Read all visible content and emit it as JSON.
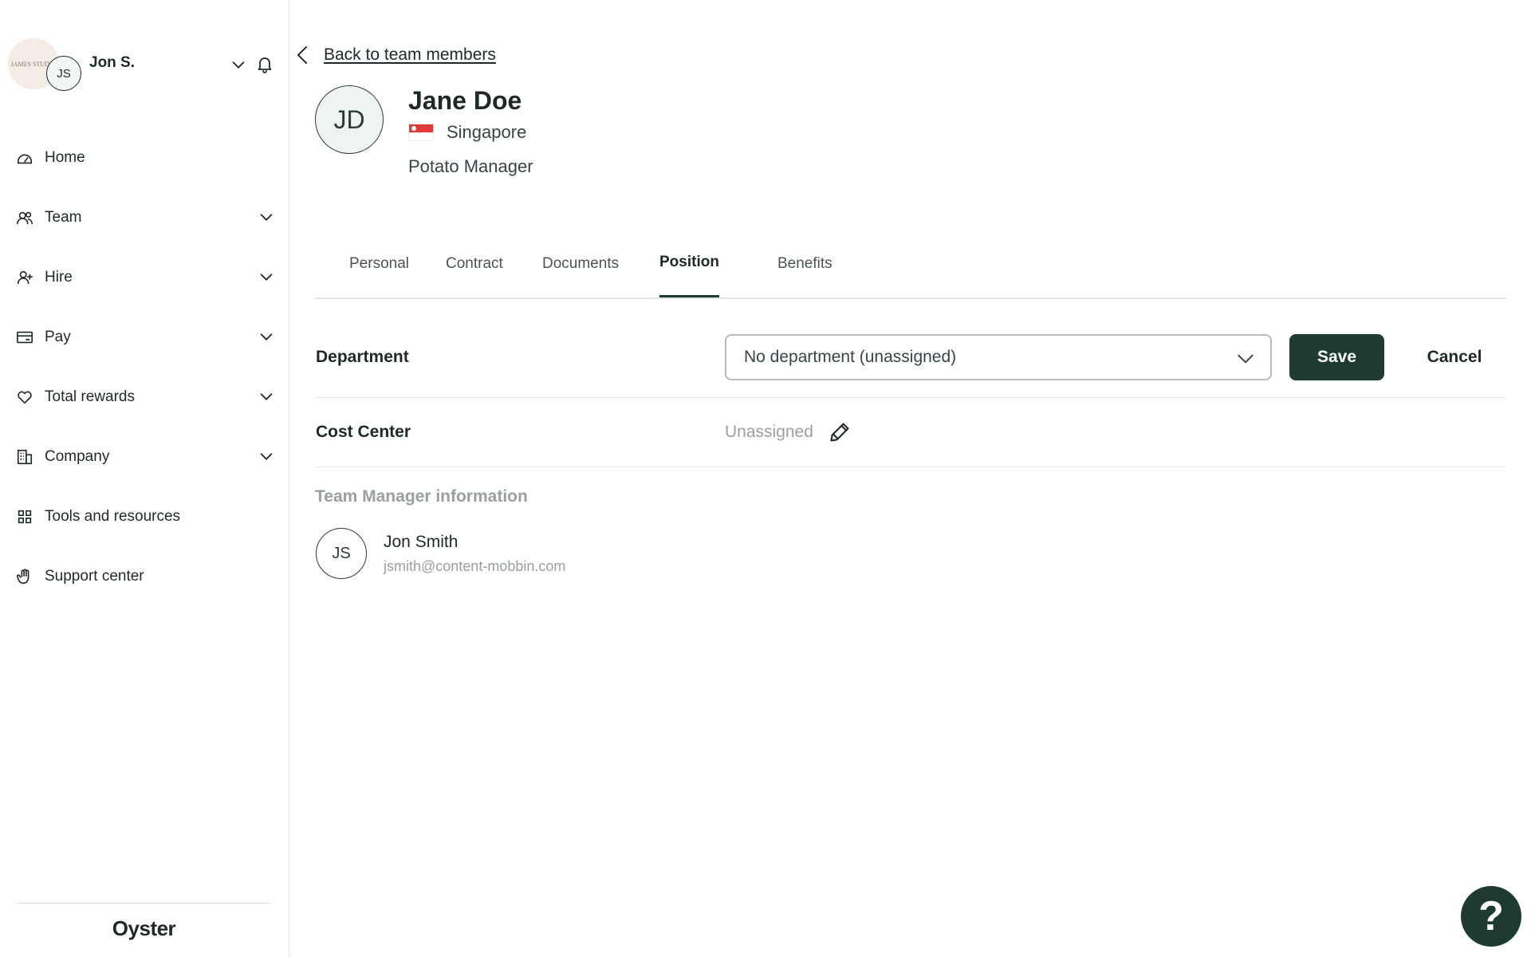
{
  "user": {
    "company_logo_text": "JAMES STUDIO",
    "avatar_initials": "JS",
    "name": "Jon S."
  },
  "nav": {
    "items": [
      {
        "label": "Home",
        "icon": "home-icon",
        "expandable": false
      },
      {
        "label": "Team",
        "icon": "team-icon",
        "expandable": true
      },
      {
        "label": "Hire",
        "icon": "hire-icon",
        "expandable": true
      },
      {
        "label": "Pay",
        "icon": "pay-icon",
        "expandable": true
      },
      {
        "label": "Total rewards",
        "icon": "heart-icon",
        "expandable": true
      },
      {
        "label": "Company",
        "icon": "company-icon",
        "expandable": true
      },
      {
        "label": "Tools and resources",
        "icon": "grid-icon",
        "expandable": false
      },
      {
        "label": "Support center",
        "icon": "hand-icon",
        "expandable": false
      }
    ]
  },
  "brand": "Oyster",
  "back_link": "Back to team members",
  "profile": {
    "initials": "JD",
    "name": "Jane Doe",
    "country": "Singapore",
    "job_title": "Potato Manager"
  },
  "tabs": [
    {
      "label": "Personal",
      "active": false
    },
    {
      "label": "Contract",
      "active": false
    },
    {
      "label": "Documents",
      "active": false
    },
    {
      "label": "Position",
      "active": true
    },
    {
      "label": "Benefits",
      "active": false
    }
  ],
  "department": {
    "label": "Department",
    "selected": "No department (unassigned)",
    "save_label": "Save",
    "cancel_label": "Cancel"
  },
  "cost_center": {
    "label": "Cost Center",
    "value": "Unassigned"
  },
  "manager": {
    "section_title": "Team Manager information",
    "initials": "JS",
    "name": "Jon Smith",
    "email": "jsmith@content-mobbin.com"
  },
  "help_button_glyph": "?",
  "colors": {
    "primary": "#1f3a33",
    "text": "#1f2a27",
    "muted": "#9aa09e",
    "border": "#e6e6e6"
  }
}
